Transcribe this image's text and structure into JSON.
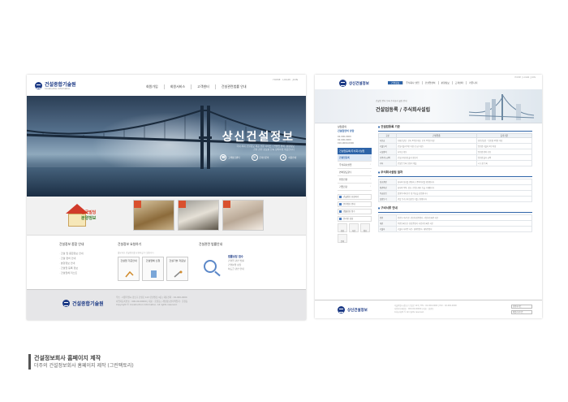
{
  "left": {
    "logo": "건설종합기술원",
    "logo_sub": "Construction Information",
    "top_util": "HOME · LOGIN · JOIN",
    "nav": [
      "회원가입",
      "회원서비스",
      "고객센터",
      "건설관련법률 안내"
    ],
    "hero": {
      "title": "상신건설정보",
      "tagline1": "국내 최대 건설정보 제공 전문 사이트 / 건설업 면허, 분양정보",
      "tagline2": "건설 관련 정보를 신속 정확하게 제공합니다",
      "icons": [
        {
          "glyph": "☎",
          "label": "고객상담센터"
        },
        {
          "glyph": "✉",
          "label": "온라인문의"
        },
        {
          "glyph": "★",
          "label": "이용안내"
        }
      ]
    },
    "strip": {
      "line1": "전국빌딩",
      "line2": "분양정보"
    },
    "col1": {
      "title": "건설정보 종합 안내",
      "items": [
        "건설 업 종합정보 안내",
        "건설 면허 안내",
        "분양정보 안내",
        "건설업 등록 정보",
        "건설업체 리스트"
      ]
    },
    "col2": {
      "title": "건설정보 요청하기",
      "desc": "필요하신 건설정보를 요청하실 수 있습니다",
      "boxes": [
        "건설업 기준안내",
        "건설업체 신청",
        "건설기술 자료실"
      ]
    },
    "col3": {
      "title": "건설관련 법률안내",
      "items": [
        "법률상담 접수",
        "건설업 관련 법률",
        "건설분쟁 상담",
        "하도급 관련 안내"
      ]
    },
    "footer": {
      "logo": "건설종합기술원",
      "lines": [
        "주소 : 서울특별시 강남구 건설로 123 건설빌딩 4층 | 대표전화 : 02-000-0000",
        "사업자등록번호 : 000-00-00000 | 대표 : 홍길동 | 개인정보관리책임자 : 홍길동",
        "Copyright © Construction Information. All rights reserved."
      ]
    }
  },
  "right": {
    "logo": "상신건설정보",
    "top_util": "HOME | LOGIN | JOIN",
    "nav": [
      "건설정보",
      "주식회사 설립",
      "건설업면허",
      "분양정보",
      "고객센터",
      "커뮤니티"
    ],
    "banner": {
      "small": "건설업 면허 등록 주식회사 설립 안내",
      "title": "건설업등록 / 주식회사설립"
    },
    "side": {
      "profile_label": "상담문의",
      "profile_name": "건설업면허 상담",
      "phones": [
        "02-000-0000",
        "02-000-0000",
        "010-0000-0000"
      ],
      "menu_head": "건설업등록/주식회사설립",
      "menu": [
        "건설업등록",
        "주식회사설립",
        "면허양도양수",
        "법인전환",
        "기업진단"
      ],
      "blocks": [
        "건설정보 요청하기",
        "분양정보 안내",
        "법률상담 접수",
        "온라인 상담"
      ],
      "tiles": [
        "상담",
        "자료",
        "정보",
        "문의"
      ]
    },
    "main": {
      "section1": "건설업등록 기준",
      "table_headers": [
        "구분",
        "건설업종",
        "등록기준"
      ],
      "table_rows": [
        [
          "자본금",
          "종합건설업 : 건축 5억원 이상, 토목 7억원 이상",
          "전문건설업 : 업종별 2억원 이상"
        ],
        [
          "기술능력",
          "건설기술자 5인 이상 (초급 이상)",
          "업종별 기술자 2인 이상"
        ],
        [
          "시설장비",
          "사무실 확보",
          "업종별 장비 보유"
        ],
        [
          "보증가능금액",
          "건설공제조합 출자 확인서",
          "업종별 출자 금액"
        ],
        [
          "기타",
          "건설업 등록 신청서 제출",
          "시·도청 등록"
        ]
      ],
      "section2": "주식회사설립 절차",
      "rows2": [
        [
          "상호결정",
          "회사의 상호를 결정하고 중복여부를 확인합니다"
        ],
        [
          "정관작성",
          "회사의 목적, 상호, 본점소재지 등을 기재합니다"
        ],
        [
          "주금납입",
          "발행주식의 인수 및 주금을 납입합니다"
        ],
        [
          "설립등기",
          "관할 등기소에 설립등기를 신청합니다"
        ]
      ],
      "section3": "구비서류 안내",
      "rows3": [
        [
          "법인",
          "법인등기부등본, 법인인감증명서, 사업자등록증 사본"
        ],
        [
          "개인",
          "주민등록등본, 인감증명서, 사업자등록증 사본"
        ],
        [
          "기술자",
          "기술자 자격증 사본, 경력증명서, 재직증명서"
        ]
      ]
    },
    "footer": {
      "logo": "상신건설정보",
      "lines": [
        "서울특별시 강남구 건설로 123 | TEL : 02-000-0000 | FAX : 02-000-0000",
        "사업자등록번호 : 000-00-00000 | 대표 : 홍길동",
        "Copyright © All rights reserved."
      ],
      "select1": "관련사이트",
      "select2": "패밀리사이트"
    }
  },
  "caption": {
    "title": "건설정보회사 홈페이지 제작",
    "subtitle": "더주의 건설정보회사 홈페이지 제작 (그린팩토리)"
  }
}
